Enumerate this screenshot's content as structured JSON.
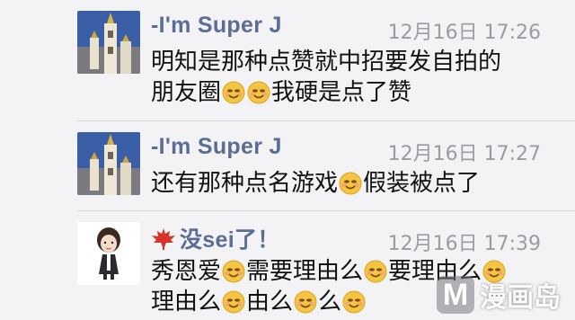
{
  "comments": [
    {
      "name": "-I'm Super J",
      "time": "12月16日 17:26",
      "line1_a": "明知是那种点赞就中招要发自拍的",
      "line2_a": "朋友圈",
      "line2_b": "我硬是点了赞"
    },
    {
      "name": "-I'm Super J",
      "time": "12月16日 17:27",
      "line1_a": "还有那种点名游戏",
      "line1_b": "假装被点了"
    },
    {
      "name": "没sei了！",
      "time": "12月16日 17:39",
      "line1_a": "秀恩爱",
      "line1_b": "需要理由么",
      "line1_c": "要理由么",
      "line2_a": "理由么",
      "line2_b": "由么",
      "line2_c": "么"
    }
  ],
  "icons": {
    "emoji": "smiling-face-icon",
    "leaf": "maple-leaf-icon"
  },
  "watermark": {
    "logo_letter": "M",
    "text": "漫画岛"
  },
  "colors": {
    "name": "#5b6d94",
    "time": "#9b9ba2",
    "background": "#f3f3f5",
    "emoji": "#f4c542"
  }
}
